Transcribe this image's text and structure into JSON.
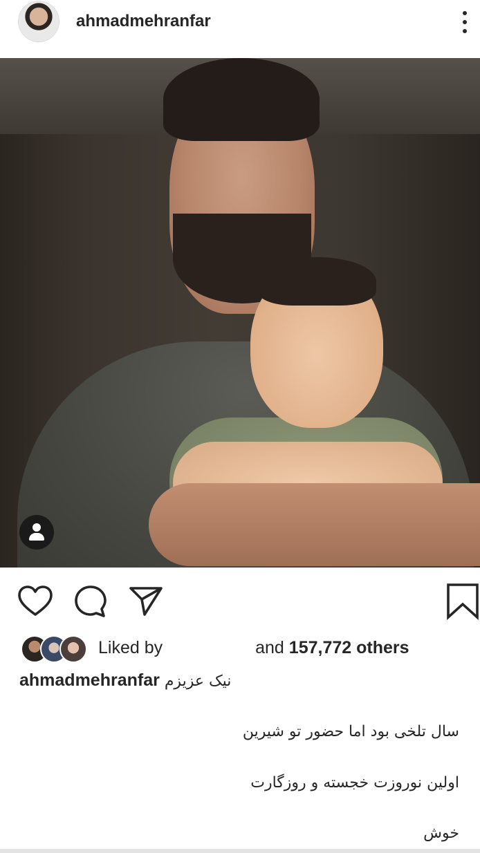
{
  "post": {
    "username": "ahmadmehranfar",
    "more_icon": "more-vertical-icon"
  },
  "actions": {
    "like_icon": "heart-icon",
    "comment_icon": "comment-icon",
    "share_icon": "send-icon",
    "save_icon": "bookmark-icon"
  },
  "likes": {
    "prefix": "Liked by",
    "conjunction": "and",
    "count_text": "157,772 others"
  },
  "caption": {
    "username": "ahmadmehranfar",
    "line1": "نیک عزیزم",
    "line2": "سال تلخی بود اما حضور تو شیرین",
    "line3": "اولین نوروزت خجسته و روزگارت",
    "line4": "خوش"
  },
  "colors": {
    "text": "#262626",
    "background": "#ffffff"
  }
}
